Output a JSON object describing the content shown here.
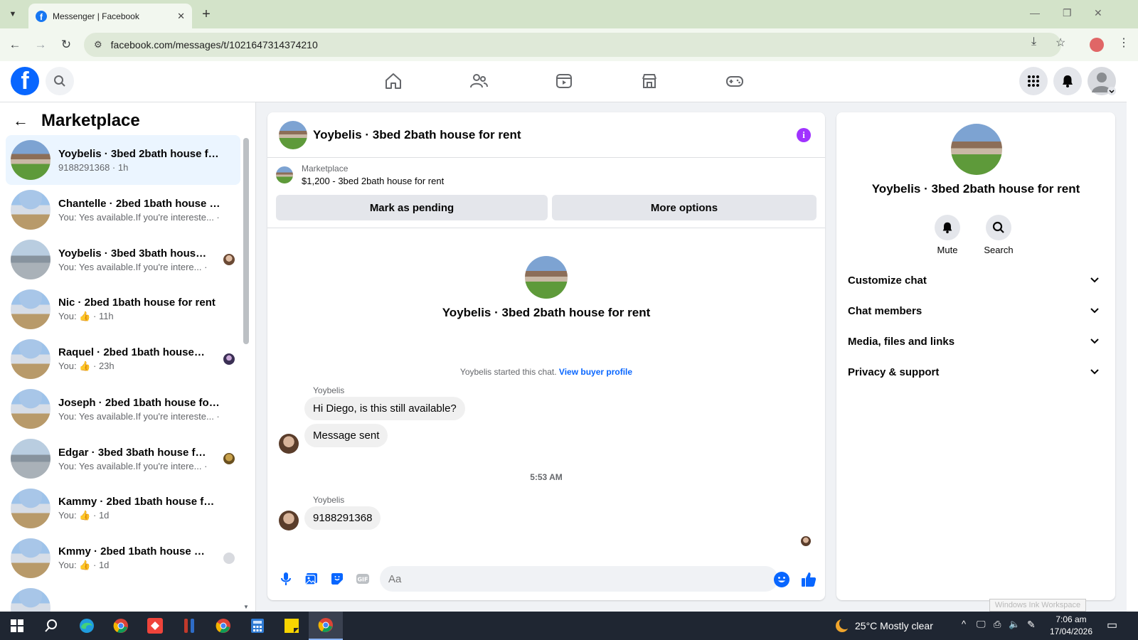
{
  "browser": {
    "tab_title": "Messenger | Facebook",
    "url": "facebook.com/messages/t/1021647314374210"
  },
  "sidebar": {
    "title": "Marketplace",
    "conversations": [
      {
        "name": "Yoybelis · 3bed 2bath house for ...",
        "preview": "9188291368 · 1h",
        "active": true
      },
      {
        "name": "Chantelle · 2bed 1bath house for...",
        "preview": "You: Yes available.If you're intereste... · 1h"
      },
      {
        "name": "Yoybelis · 3bed 3bath house f...",
        "preview": "You: Yes available.If you're intere... · 1h"
      },
      {
        "name": "Nic · 2bed 1bath house for rent",
        "preview_prefix": "You:",
        "preview": "· 11h"
      },
      {
        "name": "Raquel · 2bed 1bath house for...",
        "preview_prefix": "You:",
        "preview": "· 23h"
      },
      {
        "name": "Joseph · 2bed 1bath house for re...",
        "preview": "You: Yes available.If you're intereste... · 1d"
      },
      {
        "name": "Edgar · 3bed 3bath house for ...",
        "preview": "You: Yes available.If you're intere... · 1d"
      },
      {
        "name": "Kammy · 2bed 1bath house for r...",
        "preview_prefix": "You:",
        "preview": "· 1d"
      },
      {
        "name": "Kmmy · 2bed 1bath house for ...",
        "preview_prefix": "You:",
        "preview": "· 1d"
      }
    ]
  },
  "chat": {
    "title": "Yoybelis · 3bed 2bath house for rent",
    "marketplace_label": "Marketplace",
    "listing": "$1,200 - 3bed 2bath house for rent",
    "mark_pending": "Mark as pending",
    "more_options": "More options",
    "center_title": "Yoybelis · 3bed 2bath house for rent",
    "started_text": "Yoybelis started this chat.",
    "view_buyer_profile": "View buyer profile",
    "sender1": "Yoybelis",
    "msg1": "Hi Diego, is this still available?",
    "msg2": "Message sent",
    "timestamp": "5:53 AM",
    "sender2": "Yoybelis",
    "msg3": "9188291368",
    "composer_placeholder": "Aa"
  },
  "info_panel": {
    "title": "Yoybelis · 3bed 2bath house for rent",
    "mute": "Mute",
    "search": "Search",
    "sections": [
      "Customize chat",
      "Chat members",
      "Media, files and links",
      "Privacy & support"
    ]
  },
  "watermark": "Windows Ink Workspace",
  "taskbar": {
    "weather": "25°C  Mostly clear",
    "time": "7:06 am",
    "date": "17/04/2026"
  },
  "colors": {
    "facebook_blue": "#0866ff",
    "info_purple": "#a033ff",
    "active_row": "#ebf5ff"
  }
}
